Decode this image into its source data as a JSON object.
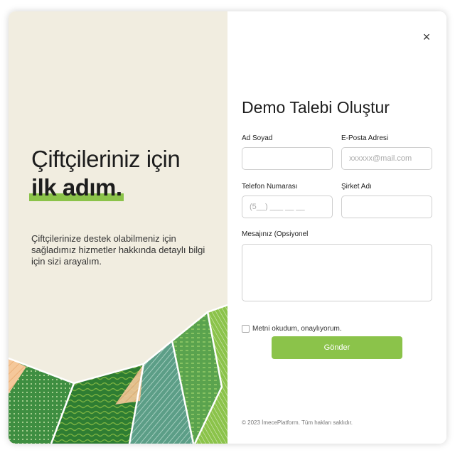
{
  "left": {
    "headline_line1": "Çiftçileriniz için",
    "headline_line2": "ilk adım.",
    "description": "Çiftçilerinize destek olabilmeniz için sağladımız hizmetler hakkında detaylı bilgi için sizi arayalım."
  },
  "modal": {
    "close_label": "×"
  },
  "form": {
    "title": "Demo Talebi Oluştur",
    "name": {
      "label": "Ad Soyad",
      "value": "",
      "placeholder": ""
    },
    "email": {
      "label": "E-Posta Adresi",
      "value": "",
      "placeholder": "xxxxxx@mail.com"
    },
    "phone": {
      "label": "Telefon Numarası",
      "value": "",
      "placeholder": "(5__) ___ __ __"
    },
    "company": {
      "label": "Şirket Adı",
      "value": "",
      "placeholder": ""
    },
    "message": {
      "label": "Mesajınız (Opsiyonel",
      "value": "",
      "placeholder": ""
    },
    "consent": {
      "label": "Metni okudum, onaylıyorum.",
      "checked": false
    },
    "submit_label": "Gönder",
    "footer": "© 2023 İmecePlatform. Tüm hakları saklıdır."
  },
  "colors": {
    "accent": "#8bc34a",
    "left_bg": "#f1ede0",
    "field_green_dark": "#2e7d32",
    "field_green": "#4caf50",
    "field_teal": "#4f9a7e",
    "field_peach": "#f5c89a"
  }
}
